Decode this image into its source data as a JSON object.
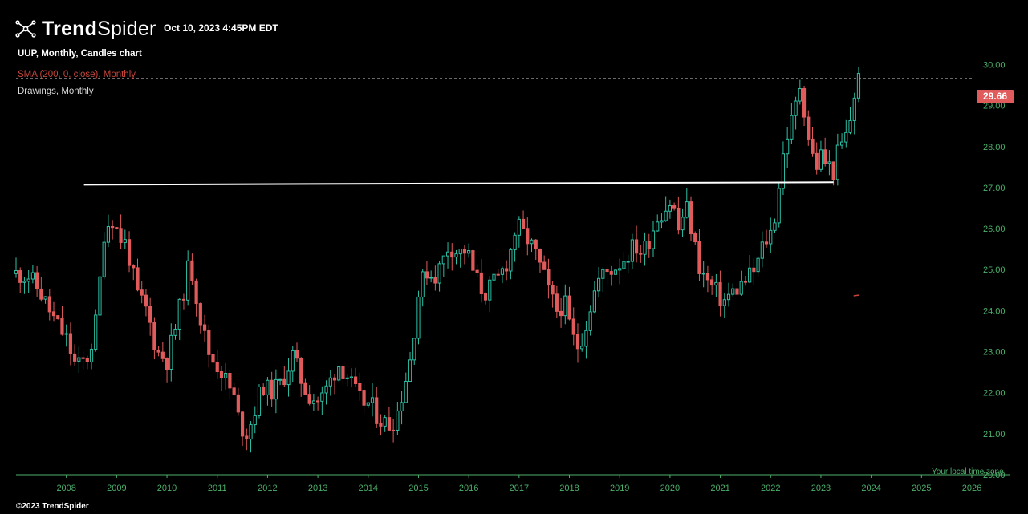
{
  "brand": {
    "name_bold": "Trend",
    "name_light": "Spider"
  },
  "timestamp": "Oct 10, 2023 4:45PM EDT",
  "info": {
    "line1": "UUP, Monthly, Candles chart",
    "line2": "SMA (200, 0, close), Monthly",
    "line3": "Drawings, Monthly"
  },
  "price_tag": "29.66",
  "timezone_label": "Your local time zone",
  "copyright": "©2023 TrendSpider",
  "colors": {
    "background": "#000000",
    "up": "#2ebfa5",
    "down": "#e05b5b",
    "axis_text": "#4caf6a",
    "sma": "#c8443a",
    "drawing": "#ffffff"
  },
  "chart_data": {
    "type": "candlestick",
    "symbol": "UUP",
    "timeframe": "Monthly",
    "x_ticks": [
      "2008",
      "2009",
      "2010",
      "2011",
      "2012",
      "2013",
      "2014",
      "2015",
      "2016",
      "2017",
      "2018",
      "2019",
      "2020",
      "2021",
      "2022",
      "2023",
      "2024",
      "2025",
      "2026"
    ],
    "y_ticks": [
      "20.00",
      "21.00",
      "22.00",
      "23.00",
      "24.00",
      "25.00",
      "26.00",
      "27.00",
      "28.00",
      "29.00",
      "30.00"
    ],
    "ylim": [
      20.0,
      30.4
    ],
    "xlim": [
      2007.0,
      2026.0
    ],
    "last_price": 29.66,
    "trendline": {
      "start": [
        2008.35,
        27.07
      ],
      "end": [
        2023.25,
        27.13
      ]
    },
    "sma_marker": [
      2023.65,
      24.38
    ],
    "closes": [
      [
        2007.0,
        24.9
      ],
      [
        2007.25,
        24.85
      ],
      [
        2007.5,
        24.4
      ],
      [
        2007.75,
        23.8
      ],
      [
        2008.0,
        23.3
      ],
      [
        2008.2,
        22.6
      ],
      [
        2008.45,
        22.9
      ],
      [
        2008.6,
        23.8
      ],
      [
        2008.75,
        25.9
      ],
      [
        2008.9,
        26.3
      ],
      [
        2009.05,
        25.8
      ],
      [
        2009.2,
        25.6
      ],
      [
        2009.4,
        24.4
      ],
      [
        2009.6,
        24.0
      ],
      [
        2009.8,
        23.0
      ],
      [
        2010.0,
        22.8
      ],
      [
        2010.15,
        23.5
      ],
      [
        2010.3,
        24.3
      ],
      [
        2010.45,
        25.2
      ],
      [
        2010.55,
        24.6
      ],
      [
        2010.7,
        23.6
      ],
      [
        2010.85,
        22.9
      ],
      [
        2011.05,
        22.6
      ],
      [
        2011.25,
        22.1
      ],
      [
        2011.35,
        21.8
      ],
      [
        2011.45,
        21.2
      ],
      [
        2011.6,
        21.0
      ],
      [
        2011.75,
        21.6
      ],
      [
        2011.9,
        22.2
      ],
      [
        2012.05,
        22.0
      ],
      [
        2012.25,
        22.2
      ],
      [
        2012.4,
        22.6
      ],
      [
        2012.5,
        22.9
      ],
      [
        2012.7,
        22.2
      ],
      [
        2012.85,
        21.9
      ],
      [
        2013.05,
        21.8
      ],
      [
        2013.25,
        22.3
      ],
      [
        2013.4,
        22.7
      ],
      [
        2013.55,
        22.5
      ],
      [
        2013.7,
        22.1
      ],
      [
        2013.85,
        21.8
      ],
      [
        2014.05,
        21.7
      ],
      [
        2014.2,
        21.4
      ],
      [
        2014.4,
        21.2
      ],
      [
        2014.55,
        21.4
      ],
      [
        2014.7,
        22.1
      ],
      [
        2014.85,
        22.9
      ],
      [
        2015.0,
        24.4
      ],
      [
        2015.15,
        25.0
      ],
      [
        2015.3,
        24.8
      ],
      [
        2015.45,
        25.1
      ],
      [
        2015.6,
        25.6
      ],
      [
        2015.8,
        25.4
      ],
      [
        2015.95,
        25.5
      ],
      [
        2016.1,
        24.9
      ],
      [
        2016.3,
        24.4
      ],
      [
        2016.45,
        24.6
      ],
      [
        2016.6,
        24.8
      ],
      [
        2016.8,
        25.3
      ],
      [
        2016.95,
        26.1
      ],
      [
        2017.05,
        25.9
      ],
      [
        2017.2,
        25.7
      ],
      [
        2017.35,
        25.3
      ],
      [
        2017.5,
        24.8
      ],
      [
        2017.6,
        24.4
      ],
      [
        2017.75,
        24.0
      ],
      [
        2017.9,
        24.2
      ],
      [
        2018.05,
        23.4
      ],
      [
        2018.15,
        23.1
      ],
      [
        2018.3,
        23.5
      ],
      [
        2018.45,
        24.3
      ],
      [
        2018.6,
        24.8
      ],
      [
        2018.8,
        25.0
      ],
      [
        2018.95,
        25.1
      ],
      [
        2019.1,
        25.3
      ],
      [
        2019.3,
        25.6
      ],
      [
        2019.45,
        25.4
      ],
      [
        2019.6,
        25.8
      ],
      [
        2019.75,
        26.3
      ],
      [
        2019.9,
        26.5
      ],
      [
        2020.05,
        26.7
      ],
      [
        2020.15,
        25.9
      ],
      [
        2020.25,
        26.3
      ],
      [
        2020.35,
        26.5
      ],
      [
        2020.45,
        25.8
      ],
      [
        2020.6,
        25.0
      ],
      [
        2020.75,
        24.7
      ],
      [
        2020.95,
        24.4
      ],
      [
        2021.05,
        24.2
      ],
      [
        2021.2,
        24.4
      ],
      [
        2021.4,
        24.6
      ],
      [
        2021.55,
        24.8
      ],
      [
        2021.7,
        25.0
      ],
      [
        2021.85,
        25.6
      ],
      [
        2022.0,
        25.9
      ],
      [
        2022.1,
        26.4
      ],
      [
        2022.2,
        27.4
      ],
      [
        2022.3,
        28.2
      ],
      [
        2022.45,
        28.7
      ],
      [
        2022.6,
        29.6
      ],
      [
        2022.7,
        28.6
      ],
      [
        2022.8,
        27.9
      ],
      [
        2022.9,
        27.5
      ],
      [
        2023.0,
        27.8
      ],
      [
        2023.1,
        27.6
      ],
      [
        2023.25,
        27.4
      ],
      [
        2023.35,
        27.9
      ],
      [
        2023.45,
        28.1
      ],
      [
        2023.55,
        28.4
      ],
      [
        2023.65,
        29.2
      ],
      [
        2023.75,
        29.66
      ]
    ]
  }
}
